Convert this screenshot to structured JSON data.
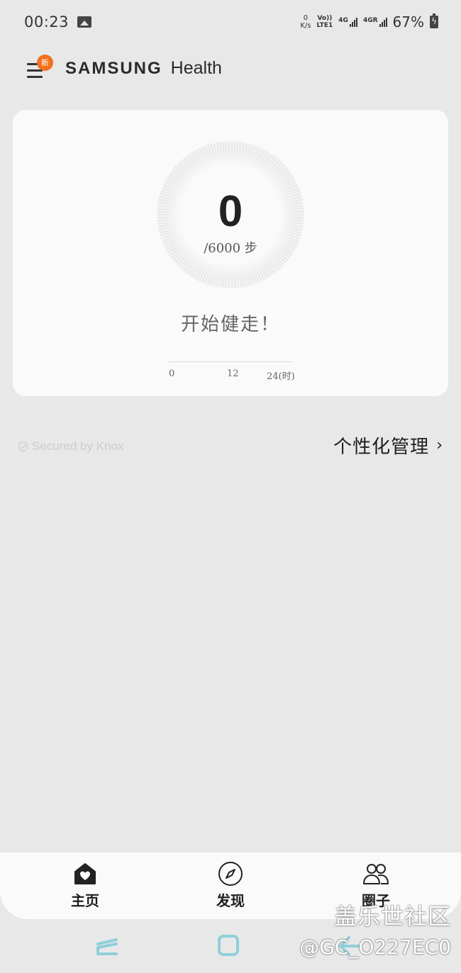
{
  "status_bar": {
    "time": "00:23",
    "net_speed_value": "0",
    "net_speed_unit": "K/s",
    "volte_top": "Vo))",
    "volte_bottom": "LTE1",
    "sim1_label": "4G",
    "sim2_label": "4GR",
    "battery": "67%"
  },
  "header": {
    "badge": "新",
    "brand_samsung": "SAMSUNG",
    "brand_health": "Health"
  },
  "steps": {
    "count": "0",
    "goal": "/6000 步",
    "progress_fraction": 0,
    "prompt": "开始健走！",
    "timeline_ticks": [
      "0",
      "12",
      "24(时)"
    ]
  },
  "info": {
    "knox": "Secured by Knox",
    "personalize": "个性化管理"
  },
  "bottom_nav": {
    "home": "主页",
    "discover": "发现",
    "circle": "圈子"
  },
  "watermark": {
    "line1": "盖乐世社区",
    "line2": "@GC_O227EC0"
  },
  "colors": {
    "badge": "#f2701f",
    "background": "#e8e8e8",
    "card": "#fafafa",
    "system_nav": "#8fcfd8"
  }
}
